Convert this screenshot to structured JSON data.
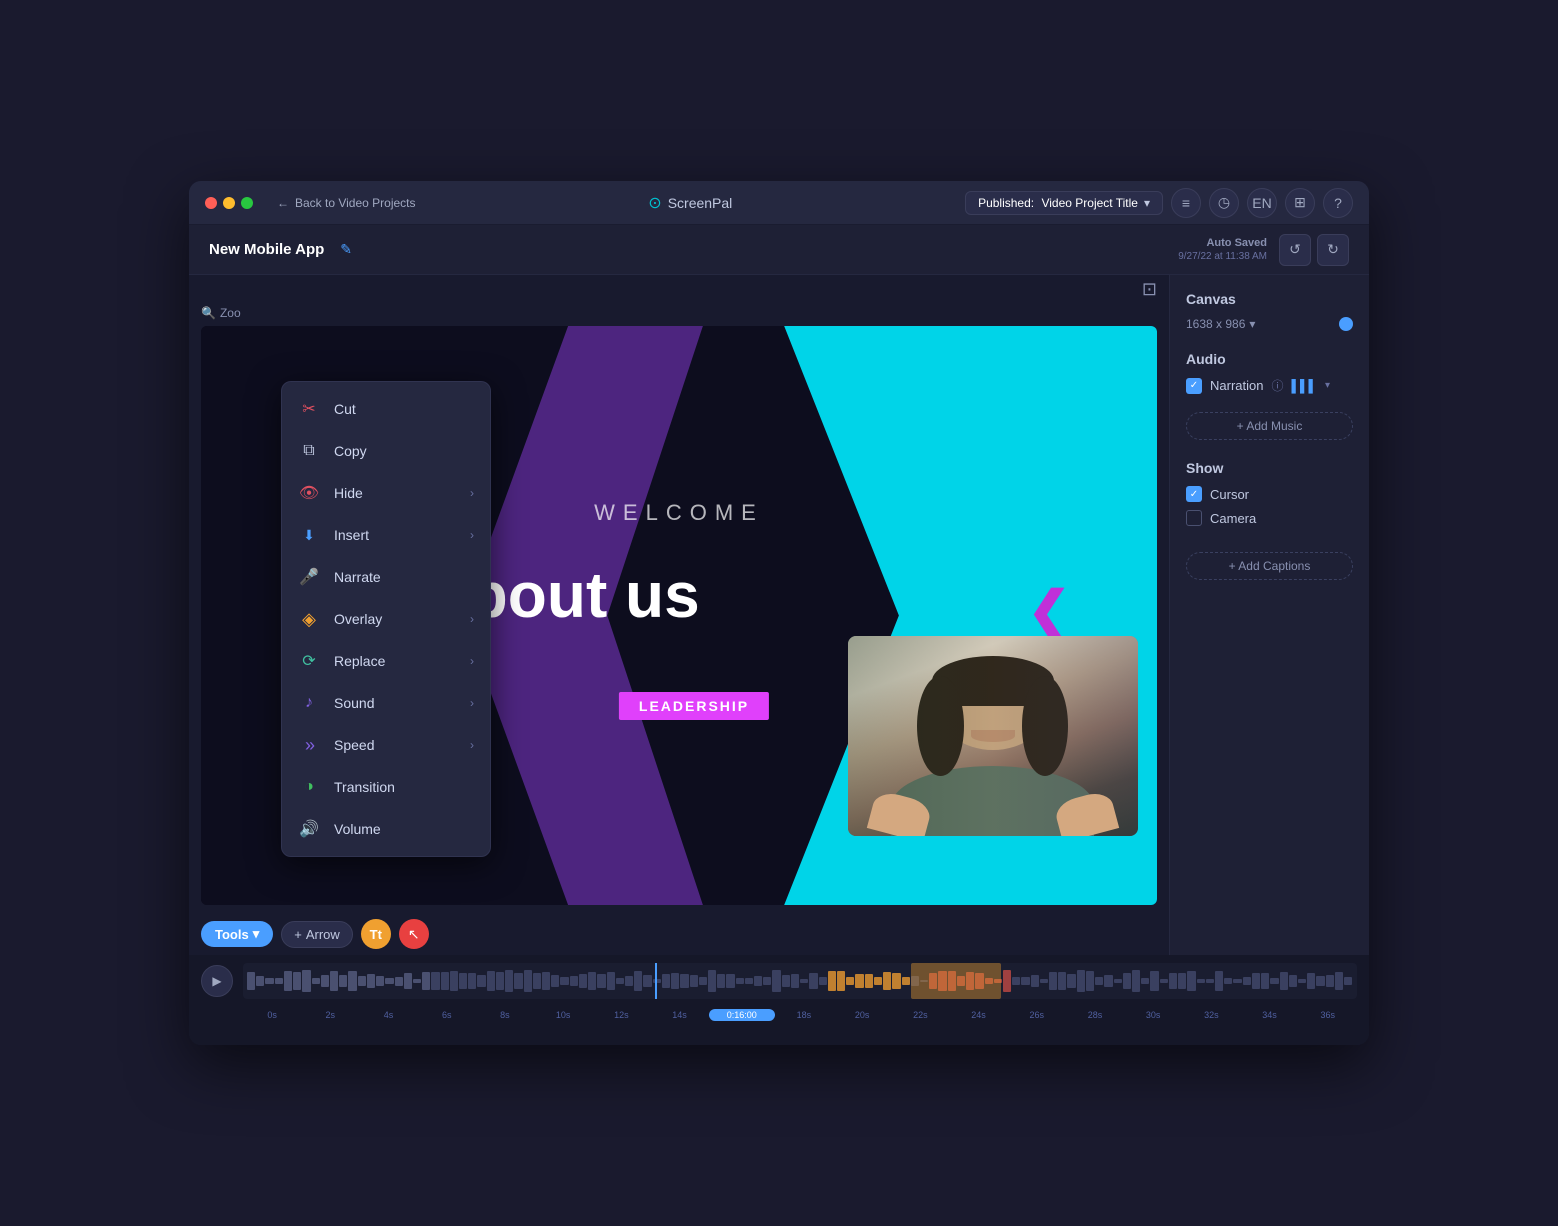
{
  "window": {
    "title": "ScreenPal"
  },
  "titleBar": {
    "backLabel": "Back to Video Projects",
    "appName": "ScreenPal",
    "publishedLabel": "Published:",
    "projectName": "Video Project Title",
    "icons": [
      "layers",
      "clock",
      "EN",
      "stack",
      "question"
    ]
  },
  "toolbar": {
    "projectTitle": "New Mobile App",
    "editIconLabel": "✎",
    "autoSavedLabel": "Auto Saved",
    "autoSavedDate": "9/27/22 at 11:38 AM",
    "undoLabel": "↺",
    "redoLabel": "↻"
  },
  "contextMenu": {
    "items": [
      {
        "id": "cut",
        "label": "Cut",
        "icon": "✂",
        "iconClass": "icon-cut",
        "hasArrow": false
      },
      {
        "id": "copy",
        "label": "Copy",
        "icon": "⧉",
        "iconClass": "icon-copy",
        "hasArrow": false
      },
      {
        "id": "hide",
        "label": "Hide",
        "icon": "👁",
        "iconClass": "icon-hide",
        "hasArrow": true
      },
      {
        "id": "insert",
        "label": "Insert",
        "icon": "⬇",
        "iconClass": "icon-insert",
        "hasArrow": true
      },
      {
        "id": "narrate",
        "label": "Narrate",
        "icon": "🎤",
        "iconClass": "icon-narrate",
        "hasArrow": false
      },
      {
        "id": "overlay",
        "label": "Overlay",
        "icon": "◈",
        "iconClass": "icon-overlay",
        "hasArrow": true
      },
      {
        "id": "replace",
        "label": "Replace",
        "icon": "⟳",
        "iconClass": "icon-replace",
        "hasArrow": true
      },
      {
        "id": "sound",
        "label": "Sound",
        "icon": "♪",
        "iconClass": "icon-sound",
        "hasArrow": true
      },
      {
        "id": "speed",
        "label": "Speed",
        "icon": "»",
        "iconClass": "icon-speed",
        "hasArrow": true
      },
      {
        "id": "transition",
        "label": "Transition",
        "icon": "◑",
        "iconClass": "icon-transition",
        "hasArrow": false
      },
      {
        "id": "volume",
        "label": "Volume",
        "icon": "🔊",
        "iconClass": "icon-volume",
        "hasArrow": false
      }
    ]
  },
  "canvas": {
    "welcomeText": "WELCOME",
    "aboutUsText": "bout us",
    "leadershipText": "LEADERSHIP",
    "resolution": "1638 x 986"
  },
  "bottomToolbar": {
    "toolsLabel": "Tools",
    "arrowLabel": "Arrow",
    "ttLabel": "Tt",
    "cursorSymbol": "↖"
  },
  "timeline": {
    "playIcon": "▶",
    "ticks": [
      "0s",
      "2s",
      "4s",
      "6s",
      "8s",
      "10s",
      "12s",
      "14s",
      "0:16:00",
      "18s",
      "20s",
      "22s",
      "24s",
      "26s",
      "28s",
      "30s",
      "32s",
      "34s",
      "36s"
    ]
  },
  "rightPanel": {
    "canvasTitle": "Canvas",
    "audioTitle": "Audio",
    "showTitle": "Show",
    "narrationLabel": "Narration",
    "addMusicLabel": "+ Add Music",
    "cursorLabel": "Cursor",
    "cameraLabel": "Camera",
    "addCaptionsLabel": "+ Add Captions",
    "resolution": "1638 x 986"
  }
}
